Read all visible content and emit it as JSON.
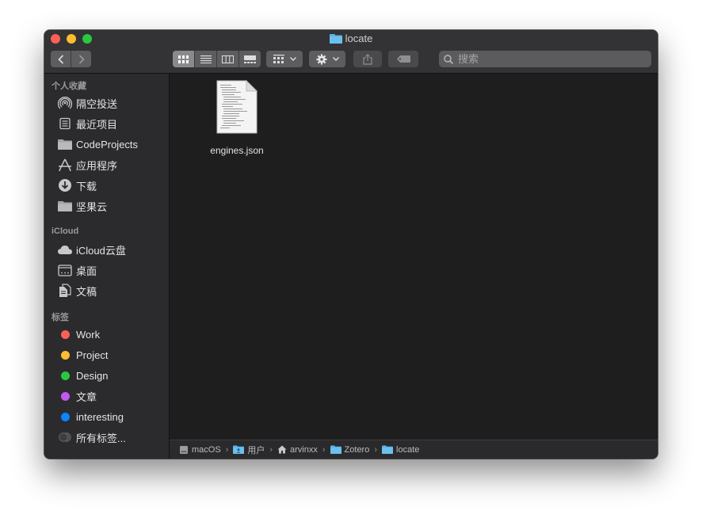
{
  "window": {
    "title": "locate"
  },
  "toolbar": {
    "search_placeholder": "搜索"
  },
  "sidebar": {
    "sections": [
      {
        "title": "个人收藏"
      },
      {
        "title": "iCloud"
      },
      {
        "title": "标签"
      }
    ],
    "favorites": [
      {
        "label": "隔空投送",
        "icon": "airdrop-icon"
      },
      {
        "label": "最近项目",
        "icon": "recents-icon"
      },
      {
        "label": "CodeProjects",
        "icon": "folder-icon"
      },
      {
        "label": "应用程序",
        "icon": "applications-icon"
      },
      {
        "label": "下载",
        "icon": "downloads-icon"
      },
      {
        "label": "坚果云",
        "icon": "folder-icon"
      }
    ],
    "icloud": [
      {
        "label": "iCloud云盘",
        "icon": "cloud-icon"
      },
      {
        "label": "桌面",
        "icon": "desktop-icon"
      },
      {
        "label": "文稿",
        "icon": "documents-icon"
      }
    ],
    "tags": [
      {
        "label": "Work",
        "color": "#fe5f57"
      },
      {
        "label": "Project",
        "color": "#febc2e"
      },
      {
        "label": "Design",
        "color": "#28c840"
      },
      {
        "label": "文章",
        "color": "#bf5af2"
      },
      {
        "label": "interesting",
        "color": "#0a84ff"
      },
      {
        "label": "所有标签...",
        "color": "#4a4a4c"
      }
    ]
  },
  "content": {
    "files": [
      {
        "name": "engines.json",
        "icon": "json-document-icon"
      }
    ]
  },
  "pathbar": {
    "crumbs": [
      {
        "label": "macOS",
        "icon": "disk-icon"
      },
      {
        "label": "用户",
        "icon": "users-folder-icon"
      },
      {
        "label": "arvinxx",
        "icon": "home-icon"
      },
      {
        "label": "Zotero",
        "icon": "folder-icon"
      },
      {
        "label": "locate",
        "icon": "folder-icon"
      }
    ]
  },
  "colors": {
    "accent_folder": "#5ab4e6",
    "window_bg": "#1e1e1f",
    "sidebar_bg": "#2b2b2d"
  }
}
